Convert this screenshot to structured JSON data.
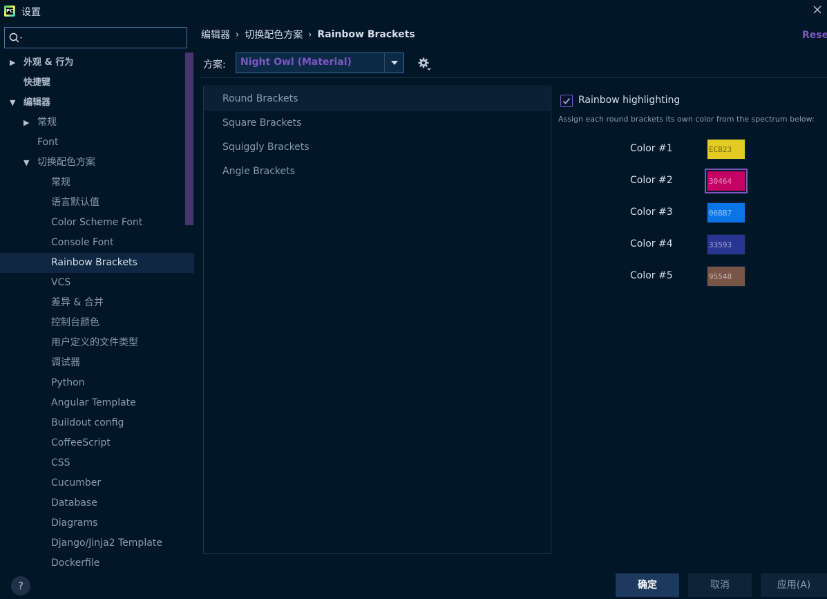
{
  "window": {
    "title": "设置"
  },
  "search": {
    "value": "",
    "placeholder": ""
  },
  "tree": [
    {
      "label": "外观 & 行为",
      "level": 0,
      "arrow": "▶",
      "bold": true
    },
    {
      "label": "快捷键",
      "level": 0,
      "arrow": "",
      "bold": true
    },
    {
      "label": "编辑器",
      "level": 0,
      "arrow": "▼",
      "bold": true
    },
    {
      "label": "常规",
      "level": 1,
      "arrow": "▶"
    },
    {
      "label": "Font",
      "level": 1,
      "arrow": ""
    },
    {
      "label": "切换配色方案",
      "level": 1,
      "arrow": "▼"
    },
    {
      "label": "常规",
      "level": 2,
      "arrow": ""
    },
    {
      "label": "语言默认值",
      "level": 2,
      "arrow": ""
    },
    {
      "label": "Color Scheme Font",
      "level": 2,
      "arrow": ""
    },
    {
      "label": "Console Font",
      "level": 2,
      "arrow": ""
    },
    {
      "label": "Rainbow Brackets",
      "level": 2,
      "arrow": "",
      "selected": true
    },
    {
      "label": "VCS",
      "level": 2,
      "arrow": ""
    },
    {
      "label": "差异 & 合并",
      "level": 2,
      "arrow": ""
    },
    {
      "label": "控制台颜色",
      "level": 2,
      "arrow": ""
    },
    {
      "label": "用户定义的文件类型",
      "level": 2,
      "arrow": ""
    },
    {
      "label": "调试器",
      "level": 2,
      "arrow": ""
    },
    {
      "label": "Python",
      "level": 2,
      "arrow": ""
    },
    {
      "label": "Angular Template",
      "level": 2,
      "arrow": ""
    },
    {
      "label": "Buildout config",
      "level": 2,
      "arrow": ""
    },
    {
      "label": "CoffeeScript",
      "level": 2,
      "arrow": ""
    },
    {
      "label": "CSS",
      "level": 2,
      "arrow": ""
    },
    {
      "label": "Cucumber",
      "level": 2,
      "arrow": ""
    },
    {
      "label": "Database",
      "level": 2,
      "arrow": ""
    },
    {
      "label": "Diagrams",
      "level": 2,
      "arrow": ""
    },
    {
      "label": "Django/Jinja2 Template",
      "level": 2,
      "arrow": ""
    },
    {
      "label": "Dockerfile",
      "level": 2,
      "arrow": ""
    }
  ],
  "breadcrumb": [
    "编辑器",
    "切换配色方案",
    "Rainbow Brackets"
  ],
  "reset_label": "Reset",
  "scheme": {
    "label": "方案:",
    "value": "Night Owl (Material)"
  },
  "bracket_types": [
    {
      "label": "Round Brackets",
      "selected": true
    },
    {
      "label": "Square Brackets"
    },
    {
      "label": "Squiggly Brackets"
    },
    {
      "label": "Angle Brackets"
    }
  ],
  "rainbow": {
    "checkbox_label": "Rainbow highlighting",
    "checked": true,
    "description": "Assign each round brackets its own color from the spectrum below:"
  },
  "colors": [
    {
      "label": "Color #1",
      "hex_text": "ECB23",
      "color": "#e2cb23"
    },
    {
      "label": "Color #2",
      "hex_text": "30464",
      "color": "#c30464",
      "focused": true
    },
    {
      "label": "Color #3",
      "hex_text": "06BB7",
      "color": "#0a74e8"
    },
    {
      "label": "Color #4",
      "hex_text": "33593",
      "color": "#283593"
    },
    {
      "label": "Color #5",
      "hex_text": "95548",
      "color": "#795548"
    }
  ],
  "buttons": {
    "ok": "确定",
    "cancel": "取消",
    "apply": "应用(A)"
  },
  "help_label": "?",
  "accent": "#7e57c2"
}
